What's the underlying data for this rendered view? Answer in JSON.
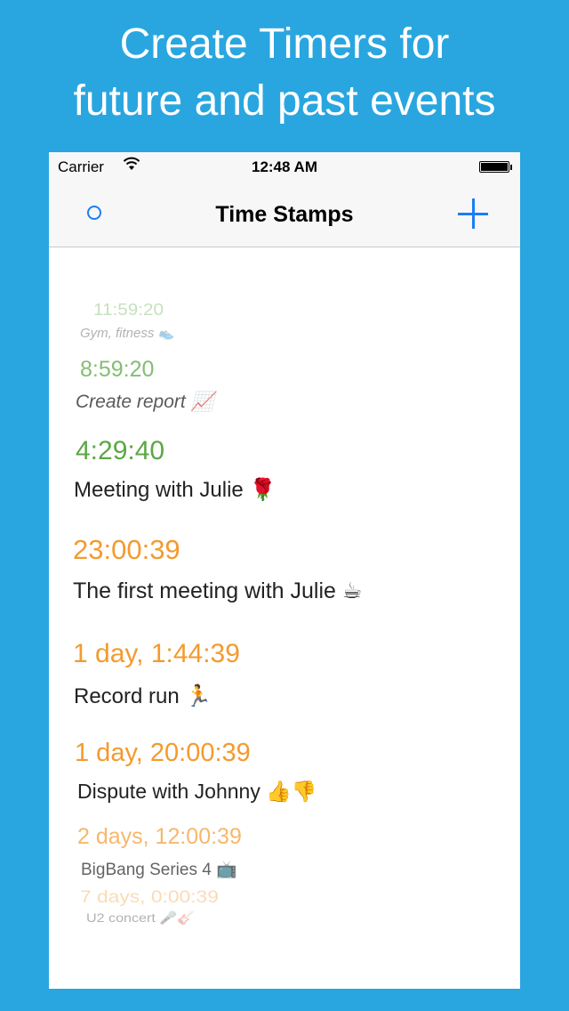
{
  "headline": {
    "line1": "Create Timers for",
    "line2": "future and past events"
  },
  "status_bar": {
    "carrier": "Carrier",
    "time": "12:48 AM"
  },
  "nav": {
    "title": "Time Stamps"
  },
  "items": [
    {
      "time": "11:59:20",
      "label": "Gym, fitness",
      "emoji": "👟"
    },
    {
      "time": "8:59:20",
      "label": "Create report",
      "emoji": "📈"
    },
    {
      "time": "4:29:40",
      "label": "Meeting with Julie",
      "emoji": "🌹"
    },
    {
      "time": "23:00:39",
      "label": "The first meeting with Julie",
      "emoji": "☕"
    },
    {
      "time": "1 day, 1:44:39",
      "label": "Record run",
      "emoji": "🏃"
    },
    {
      "time": "1 day, 20:00:39",
      "label": "Dispute with Johnny",
      "emoji": "👍👎"
    },
    {
      "time": "2 days, 12:00:39",
      "label": "BigBang Series 4",
      "emoji": "📺"
    },
    {
      "time": "7 days, 0:00:39",
      "label": "U2 concert",
      "emoji": "🎤🎸"
    }
  ],
  "colors": {
    "background": "#29a6e0",
    "accent": "#1a7ef5",
    "past": "#5ba745",
    "future": "#f49a2e"
  }
}
